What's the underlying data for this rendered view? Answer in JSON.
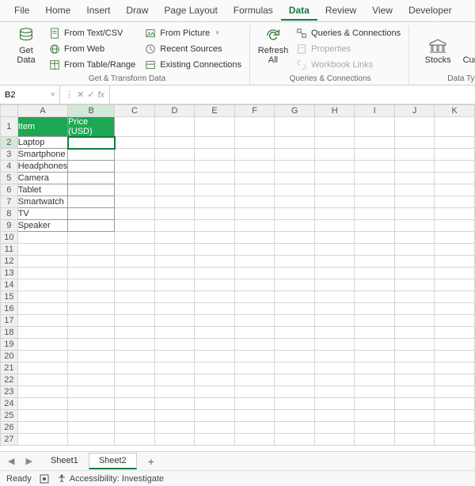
{
  "menu": {
    "tabs": [
      "File",
      "Home",
      "Insert",
      "Draw",
      "Page Layout",
      "Formulas",
      "Data",
      "Review",
      "View",
      "Developer"
    ],
    "active": 6
  },
  "ribbon": {
    "getData": {
      "label": "Get\nData",
      "dropdown": "˅"
    },
    "transform": {
      "items": [
        "From Text/CSV",
        "From Web",
        "From Table/Range",
        "From Picture",
        "Recent Sources",
        "Existing Connections"
      ],
      "groupLabel": "Get & Transform Data"
    },
    "refresh": {
      "label": "Refresh\nAll",
      "dropdown": "˅"
    },
    "queries": {
      "items": [
        "Queries & Connections",
        "Properties",
        "Workbook Links"
      ],
      "groupLabel": "Queries & Connections"
    },
    "types": {
      "stocks": "Stocks",
      "currencies": "Currencies",
      "groupLabel": "Data Types"
    }
  },
  "nameBox": "B2",
  "fx": "fx",
  "formula": "",
  "sheet": {
    "cols": [
      "A",
      "B",
      "C",
      "D",
      "E",
      "F",
      "G",
      "H",
      "I",
      "J",
      "K"
    ],
    "rowCount": 27,
    "headerRow": [
      "Item",
      "Price (USD)"
    ],
    "dataA": [
      "Laptop",
      "Smartphone",
      "Headphones",
      "Camera",
      "Tablet",
      "Smartwatch",
      "TV",
      "Speaker"
    ],
    "activeCell": "B2",
    "selCol": 1,
    "selRow": 1
  },
  "sheetTabs": {
    "tabs": [
      "Sheet1",
      "Sheet2"
    ],
    "active": 1,
    "add": "+"
  },
  "status": {
    "ready": "Ready",
    "access": "Accessibility: Investigate"
  }
}
